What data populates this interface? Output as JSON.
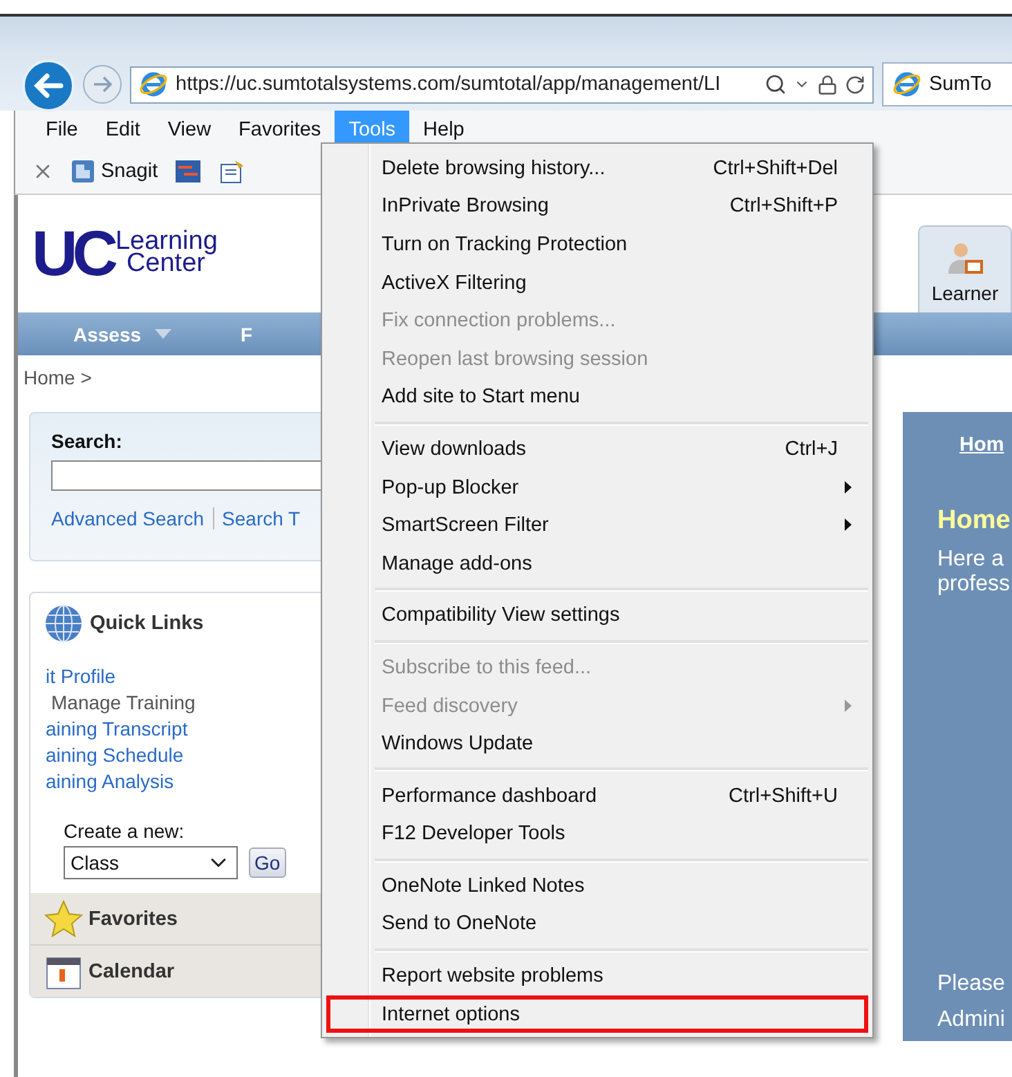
{
  "browser": {
    "address": "https://uc.sumtotalsystems.com/sumtotal/app/management/LI",
    "tab_title": "SumTo"
  },
  "menu_bar": [
    {
      "label": "File",
      "selected": false
    },
    {
      "label": "Edit",
      "selected": false
    },
    {
      "label": "View",
      "selected": false
    },
    {
      "label": "Favorites",
      "selected": false
    },
    {
      "label": "Tools",
      "selected": true
    },
    {
      "label": "Help",
      "selected": false
    }
  ],
  "command_bar": {
    "snagit_label": "Snagit"
  },
  "page": {
    "logo": {
      "initials": "UC",
      "line_1": "Learning",
      "line_2": "Center"
    },
    "role_tab": "Learner",
    "nav": [
      {
        "label": "Assess",
        "caret": true
      },
      {
        "label": "F",
        "caret": false
      }
    ],
    "breadcrumb": "Home >",
    "search": {
      "label": "Search:",
      "links": [
        "Advanced Search",
        "Search T"
      ]
    },
    "quick_links": {
      "title": "Quick Links",
      "links": [
        {
          "label": "it Profile",
          "kind": "link"
        },
        {
          "label": "Manage Training",
          "kind": "text"
        },
        {
          "label": "aining Transcript",
          "kind": "link"
        },
        {
          "label": "aining Schedule",
          "kind": "link"
        },
        {
          "label": "aining Analysis",
          "kind": "link"
        }
      ],
      "create_label": "Create a new:",
      "create_value": "Class",
      "go_button": "Go"
    },
    "sections": [
      {
        "label": "Favorites",
        "kind": "star"
      },
      {
        "label": "Calendar",
        "kind": "calendar"
      }
    ],
    "right_panel": {
      "link": "Hom",
      "heading": "Home",
      "text_lines": [
        "Here a",
        "profess"
      ],
      "footer_lines": [
        "Please",
        "Admini"
      ]
    }
  },
  "tools_menu": {
    "groups": [
      [
        {
          "label": "Delete browsing history...",
          "shortcut": "Ctrl+Shift+Del",
          "disabled": false,
          "submenu": false,
          "outlined": false
        },
        {
          "label": "InPrivate Browsing",
          "shortcut": "Ctrl+Shift+P",
          "disabled": false,
          "submenu": false,
          "outlined": false
        },
        {
          "label": "Turn on Tracking Protection",
          "disabled": false,
          "submenu": false,
          "outlined": false
        },
        {
          "label": "ActiveX Filtering",
          "disabled": false,
          "submenu": false,
          "outlined": false
        },
        {
          "label": "Fix connection problems...",
          "disabled": true,
          "submenu": false,
          "outlined": false
        },
        {
          "label": "Reopen last browsing session",
          "disabled": true,
          "submenu": false,
          "outlined": false
        },
        {
          "label": "Add site to Start menu",
          "disabled": false,
          "submenu": false,
          "outlined": false
        }
      ],
      [
        {
          "label": "View downloads",
          "shortcut": "Ctrl+J",
          "disabled": false,
          "submenu": false,
          "outlined": false
        },
        {
          "label": "Pop-up Blocker",
          "disabled": false,
          "submenu": true,
          "outlined": false
        },
        {
          "label": "SmartScreen Filter",
          "disabled": false,
          "submenu": true,
          "outlined": false
        },
        {
          "label": "Manage add-ons",
          "disabled": false,
          "submenu": false,
          "outlined": false
        }
      ],
      [
        {
          "label": "Compatibility View settings",
          "disabled": false,
          "submenu": false,
          "outlined": false
        }
      ],
      [
        {
          "label": "Subscribe to this feed...",
          "disabled": true,
          "submenu": false,
          "outlined": false
        },
        {
          "label": "Feed discovery",
          "disabled": true,
          "submenu": true,
          "outlined": false
        },
        {
          "label": "Windows Update",
          "disabled": false,
          "submenu": false,
          "outlined": false
        }
      ],
      [
        {
          "label": "Performance dashboard",
          "shortcut": "Ctrl+Shift+U",
          "disabled": false,
          "submenu": false,
          "outlined": false
        },
        {
          "label": "F12 Developer Tools",
          "disabled": false,
          "submenu": false,
          "outlined": false
        }
      ],
      [
        {
          "label": "OneNote Linked Notes",
          "disabled": false,
          "submenu": false,
          "outlined": false
        },
        {
          "label": "Send to OneNote",
          "disabled": false,
          "submenu": false,
          "outlined": false
        }
      ],
      [
        {
          "label": "Report website problems",
          "disabled": false,
          "submenu": false,
          "outlined": false
        },
        {
          "label": "Internet options",
          "disabled": false,
          "submenu": false,
          "outlined": true
        }
      ]
    ]
  }
}
